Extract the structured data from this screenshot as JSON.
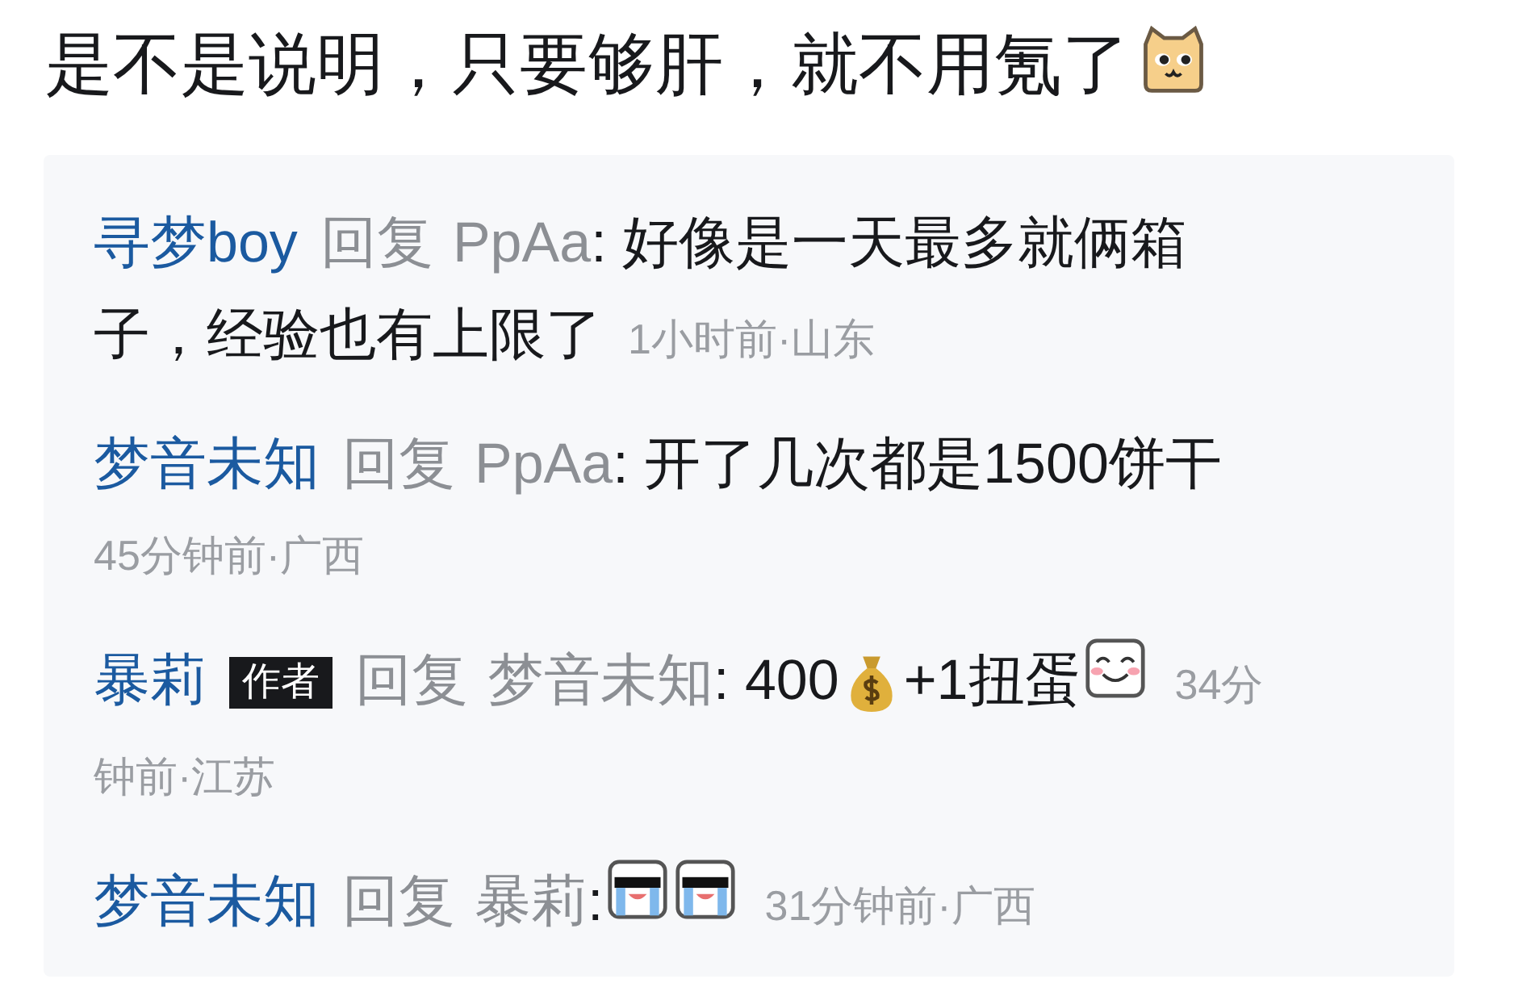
{
  "post": {
    "content": [
      {
        "kind": "text",
        "text": "是不是说明，只要够肝，就不用氪了"
      },
      {
        "kind": "dog_face"
      }
    ]
  },
  "replies": [
    {
      "lines": [
        [
          {
            "kind": "user",
            "text": "寻梦boy"
          },
          {
            "kind": "reply_label",
            "text": "回复"
          },
          {
            "kind": "target",
            "text": "PpAa"
          },
          {
            "kind": "text",
            "text": ": 好像是一天最多就俩箱"
          }
        ],
        [
          {
            "kind": "text",
            "text": "子，经验也有上限了"
          },
          {
            "kind": "time",
            "text": "1小时前·山东"
          }
        ]
      ]
    },
    {
      "lines": [
        [
          {
            "kind": "user",
            "text": "梦音未知"
          },
          {
            "kind": "reply_label",
            "text": "回复"
          },
          {
            "kind": "target",
            "text": "PpAa"
          },
          {
            "kind": "text",
            "text": ": 开了几次都是1500饼干"
          }
        ],
        [
          {
            "kind": "time",
            "text": "45分钟前·广西"
          }
        ]
      ]
    },
    {
      "lines": [
        [
          {
            "kind": "user",
            "text": "暴莉"
          },
          {
            "kind": "badge",
            "text": "作者"
          },
          {
            "kind": "reply_label",
            "text": "回复"
          },
          {
            "kind": "target",
            "text": "梦音未知"
          },
          {
            "kind": "text",
            "text": ": 400"
          },
          {
            "kind": "money_bag"
          },
          {
            "kind": "text",
            "text": "+1扭蛋"
          },
          {
            "kind": "smile_face"
          },
          {
            "kind": "time",
            "text": "34分"
          }
        ],
        [
          {
            "kind": "time",
            "text": "钟前·江苏"
          }
        ]
      ]
    },
    {
      "lines": [
        [
          {
            "kind": "user",
            "text": "梦音未知"
          },
          {
            "kind": "reply_label",
            "text": "回复"
          },
          {
            "kind": "target",
            "text": "暴莉"
          },
          {
            "kind": "text",
            "text": ":"
          },
          {
            "kind": "crying_shades"
          },
          {
            "kind": "crying_shades"
          },
          {
            "kind": "time",
            "text": "31分钟前·广西"
          }
        ]
      ]
    }
  ]
}
